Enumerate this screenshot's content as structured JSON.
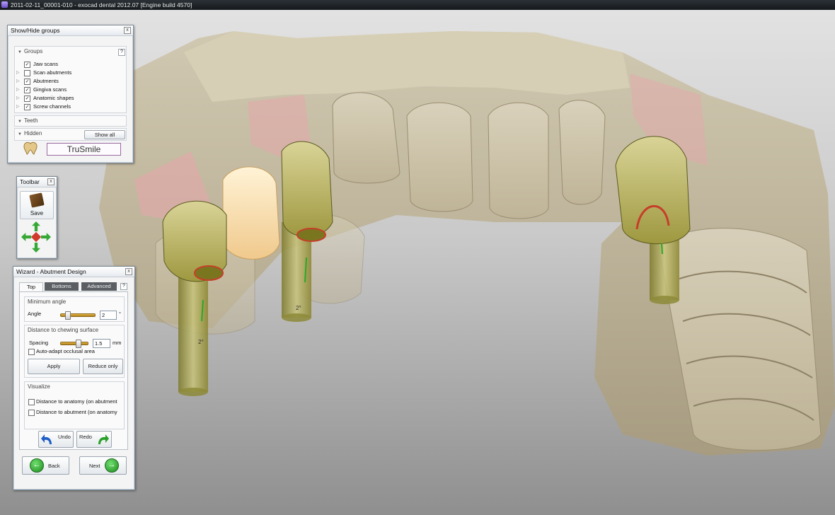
{
  "window": {
    "title": "2011-02-11_00001-010 - exocad dental 2012.07 [Engine build 4570]"
  },
  "showhide": {
    "title": "Show/Hide groups",
    "close": "x",
    "groups_label": "Groups",
    "help": "?",
    "items": [
      {
        "label": "Jaw scans",
        "mark": "✓"
      },
      {
        "label": "Scan abutments",
        "mark": ""
      },
      {
        "label": "Abutments",
        "mark": "✓"
      },
      {
        "label": "Gingiva scans",
        "mark": "✓"
      },
      {
        "label": "Anatomic shapes",
        "mark": "✓"
      },
      {
        "label": "Screw channels",
        "mark": "✓"
      }
    ],
    "teeth_label": "Teeth",
    "hidden_label": "Hidden",
    "show_all": "Show all",
    "brand": "TruSmile"
  },
  "toolbar": {
    "title": "Toolbar",
    "close": "x",
    "save_label": "Save"
  },
  "wizard": {
    "title": "Wizard - Abutment Design",
    "close": "x",
    "tabs": [
      "Top",
      "Bottoms",
      "Advanced"
    ],
    "help": "?",
    "min_angle": {
      "title": "Minimum angle",
      "label": "Angle",
      "value": "2",
      "unit": "°",
      "fraction": 0.2
    },
    "distance": {
      "title": "Distance to chewing surface",
      "label": "Spacing",
      "value": "1.5",
      "unit": "mm",
      "fraction": 0.65,
      "auto_adapt": "Auto-adapt occlusal area",
      "apply": "Apply",
      "reduce_only": "Reduce only"
    },
    "visualize": {
      "title": "Visualize",
      "anatomy": "Distance to anatomy (on abutment",
      "abutment": "Distance to abutment (on anatomy"
    },
    "undo": "Undo",
    "redo": "Redo",
    "back": "Back",
    "next": "Next"
  },
  "scene": {
    "angle_labels": [
      "2°",
      "2°"
    ]
  },
  "colors": {
    "accent_green": "#1d8a1d",
    "abutment": "#9c9a3a",
    "jaw": "#c9bfa5",
    "gingiva": "#e8a6ac"
  }
}
